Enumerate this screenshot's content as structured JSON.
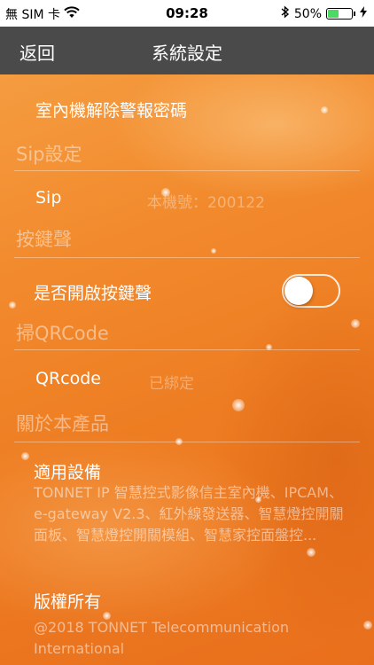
{
  "status_bar": {
    "carrier": "無 SIM 卡",
    "time": "09:28",
    "battery_percent": "50%",
    "battery_level": 0.5
  },
  "nav": {
    "back_label": "返回",
    "title": "系統設定"
  },
  "rows": {
    "alarm_password": "室內機解除警報密碼",
    "sip_header": "Sip設定",
    "sip_label": "Sip",
    "sip_value": "本機號：200122",
    "key_sound_header": "按鍵聲",
    "key_sound_label": "是否開啟按鍵聲",
    "key_sound_enabled": false,
    "qrcode_header": "掃QRCode",
    "qrcode_label": "QRcode",
    "qrcode_value": "已綁定",
    "about_header": "關於本產品",
    "device_label": "適用設備",
    "device_desc": "TONNET IP 智慧控式影像信主室內機、IPCAM、e-gateway V2.3、紅外線發送器、智慧燈控開關面板、智慧燈控開關模組、智慧家控面盤控...",
    "copyright_label": "版權所有",
    "copyright_desc": "@2018 TONNET Telecommunication International"
  },
  "colors": {
    "nav_bg": "#4a4a4a",
    "background": "#f08a2e",
    "battery_green": "#4cd964"
  }
}
